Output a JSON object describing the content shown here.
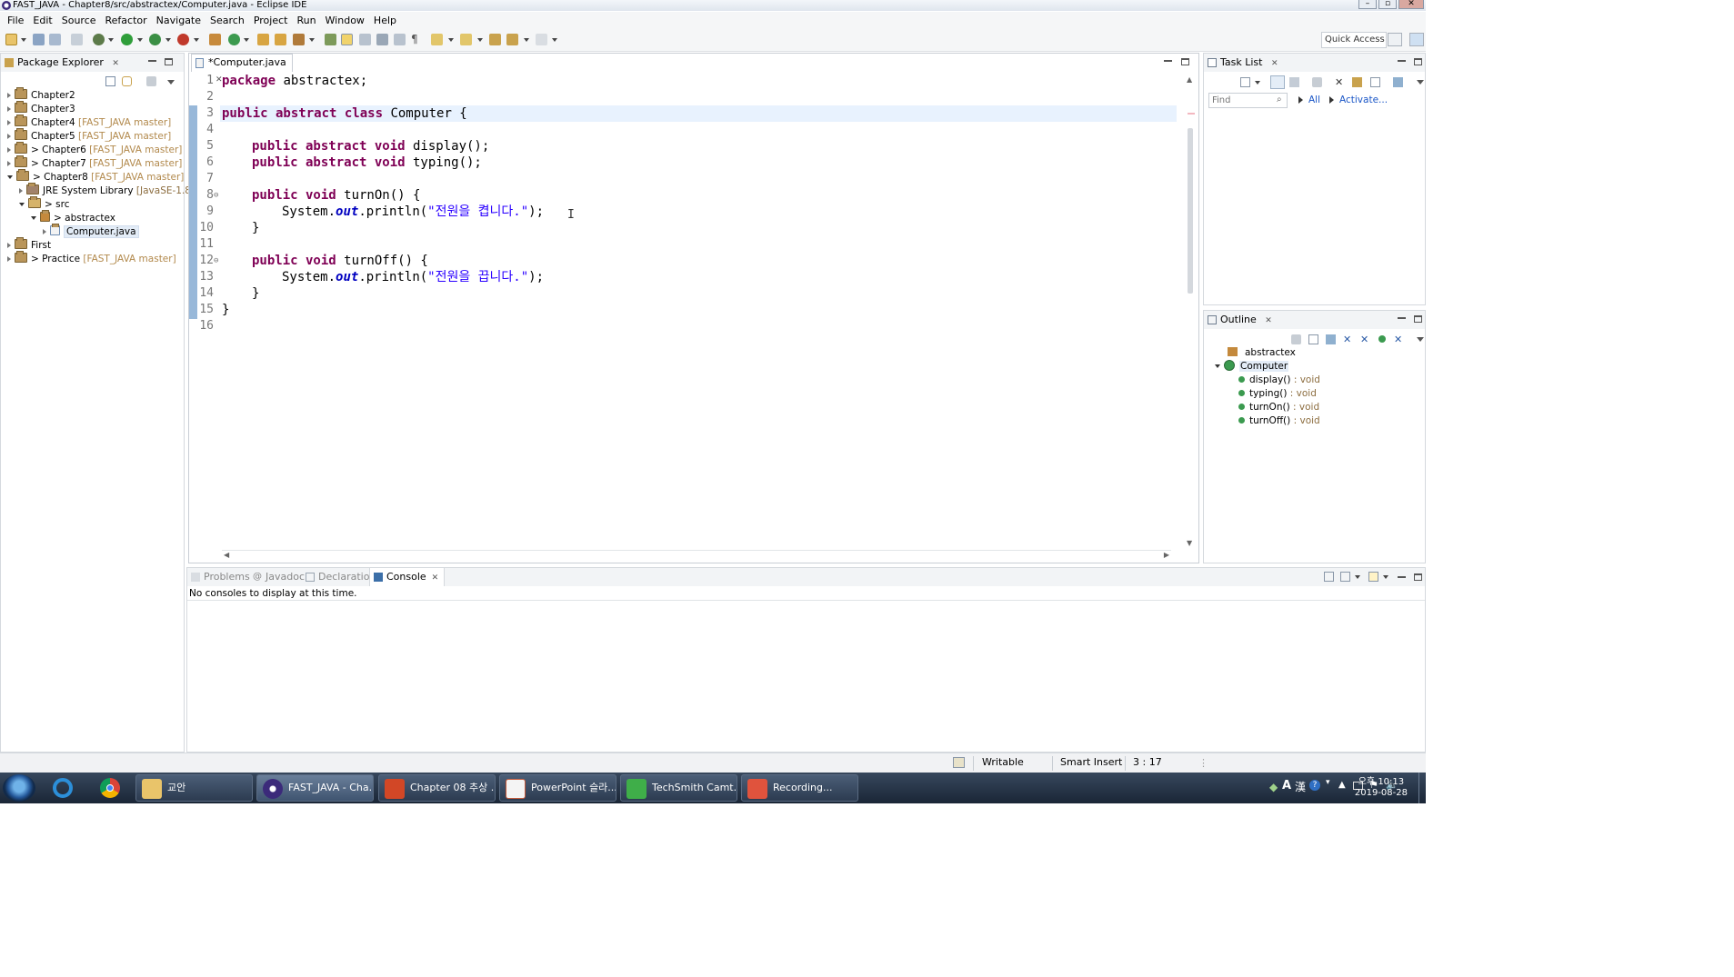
{
  "window": {
    "title": "FAST_JAVA - Chapter8/src/abstractex/Computer.java - Eclipse IDE"
  },
  "menu": [
    "File",
    "Edit",
    "Source",
    "Refactor",
    "Navigate",
    "Search",
    "Project",
    "Run",
    "Window",
    "Help"
  ],
  "toolbar": {
    "quick_access": "Quick Access"
  },
  "package_explorer": {
    "title": "Package Explorer",
    "items": [
      {
        "label": "Chapter2",
        "suffix": ""
      },
      {
        "label": "Chapter3",
        "suffix": ""
      },
      {
        "label": "Chapter4",
        "suffix": " [FAST_JAVA master]"
      },
      {
        "label": "Chapter5",
        "suffix": " [FAST_JAVA master]"
      },
      {
        "label": "> Chapter6",
        "suffix": " [FAST_JAVA master]"
      },
      {
        "label": "> Chapter7",
        "suffix": " [FAST_JAVA master]"
      },
      {
        "label": "> Chapter8",
        "suffix": " [FAST_JAVA master]"
      },
      {
        "label": "JRE System Library",
        "suffix": " [JavaSE-1.8]"
      },
      {
        "label": "> src",
        "suffix": ""
      },
      {
        "label": "> abstractex",
        "suffix": ""
      },
      {
        "label": "Computer.java",
        "suffix": ""
      },
      {
        "label": "First",
        "suffix": ""
      },
      {
        "label": "> Practice",
        "suffix": " [FAST_JAVA master]"
      }
    ]
  },
  "editor": {
    "tab_label": "*Computer.java",
    "line_numbers": [
      "1",
      "2",
      "3",
      "4",
      "5",
      "6",
      "7",
      "8",
      "9",
      "10",
      "11",
      "12",
      "13",
      "14",
      "15",
      "16"
    ],
    "lines": {
      "l1_kw": "package",
      "l1_rest": " abstractex;",
      "l3_kw": "public abstract class",
      "l3_rest": " Computer {",
      "l5_kw": "public abstract void",
      "l5_rest": " display();",
      "l6_kw": "public abstract void",
      "l6_rest": " typing();",
      "l8_kw": "public void",
      "l8_rest": " turnOn() {",
      "l9_pre": "System.",
      "l9_field": "out",
      "l9_mid": ".println(",
      "l9_str": "\"전원을 켭니다.\"",
      "l9_end": ");",
      "l10": "}",
      "l12_kw": "public void",
      "l12_rest": " turnOff() {",
      "l13_pre": "System.",
      "l13_field": "out",
      "l13_mid": ".println(",
      "l13_str": "\"전원을 끕니다.\"",
      "l13_end": ");",
      "l14": "}",
      "l15": "}"
    }
  },
  "task_list": {
    "title": "Task List",
    "find_placeholder": "Find",
    "all": "All",
    "activate": "Activate..."
  },
  "outline": {
    "title": "Outline",
    "package": "abstractex",
    "class": "Computer",
    "members": [
      {
        "name": "display()",
        "type": " : void"
      },
      {
        "name": "typing()",
        "type": " : void"
      },
      {
        "name": "turnOn()",
        "type": " : void"
      },
      {
        "name": "turnOff()",
        "type": " : void"
      }
    ]
  },
  "bottom_panel": {
    "tabs": [
      "Problems",
      "Javadoc",
      "Declaration",
      "Console"
    ],
    "console_message": "No consoles to display at this time."
  },
  "status_bar": {
    "writable": "Writable",
    "insert_mode": "Smart Insert",
    "position": "3 : 17"
  },
  "taskbar": {
    "tasks": [
      "교안",
      "FAST_JAVA - Cha...",
      "Chapter 08 추상 ...",
      "PowerPoint 슬라...",
      "TechSmith Camt...",
      "Recording..."
    ],
    "clock_time": "오후 10:13",
    "clock_date": "2019-08-28"
  },
  "colors": {
    "keyword": "#7f0055",
    "string": "#2a00ff",
    "static_field": "#0000c0",
    "git_decoration": "#b2894c"
  }
}
